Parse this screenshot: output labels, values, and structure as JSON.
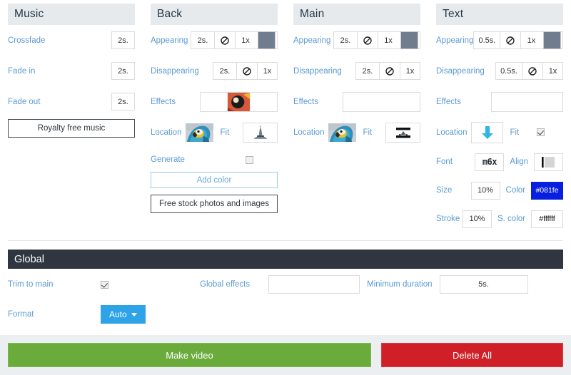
{
  "panels": [
    {
      "title": "Music",
      "rows": [
        {
          "label": "Crossfade",
          "value": "2s."
        },
        {
          "label": "Fade in",
          "value": "2s."
        },
        {
          "label": "Fade out",
          "value": "2s."
        }
      ],
      "button": "Royalty free music"
    },
    {
      "title": "Back",
      "appearing": {
        "label": "Appearing",
        "duration": "2s.",
        "speed": "1x",
        "icon": "no-entry-icon",
        "color": "#707d8f"
      },
      "disappearing": {
        "label": "Disappearing",
        "duration": "2s.",
        "speed": "1x",
        "icon": "no-entry-icon"
      },
      "effects": {
        "label": "Effects",
        "thumb": "effect-thumbnail"
      },
      "location": {
        "label": "Location",
        "thumb": "parrot-thumbnail"
      },
      "fit": {
        "label": "Fit",
        "icon": "tower-fit-icon"
      },
      "generate": {
        "label": "Generate",
        "checked": false
      },
      "add_color": "Add color",
      "free_stock": "Free stock photos and images"
    },
    {
      "title": "Main",
      "appearing": {
        "label": "Appearing",
        "duration": "2s.",
        "speed": "1x",
        "icon": "no-entry-icon",
        "color": "#707d8f"
      },
      "disappearing": {
        "label": "Disappearing",
        "duration": "2s.",
        "speed": "1x",
        "icon": "no-entry-icon"
      },
      "effects": {
        "label": "Effects",
        "value": ""
      },
      "location": {
        "label": "Location",
        "thumb": "parrot-thumbnail"
      },
      "fit": {
        "label": "Fit",
        "icon": "crop-bars-fit-icon"
      }
    },
    {
      "title": "Text",
      "appearing": {
        "label": "Appearing",
        "duration": "0.5s.",
        "speed": "1x",
        "icon": "no-entry-icon",
        "color": "#707d8f"
      },
      "disappearing": {
        "label": "Disappearing",
        "duration": "0.5s.",
        "speed": "1x",
        "icon": "no-entry-icon"
      },
      "effects": {
        "label": "Effects",
        "value": ""
      },
      "location": {
        "label": "Location",
        "icon": "down-arrow-icon"
      },
      "fit": {
        "label": "Fit",
        "checked": true
      },
      "font": {
        "label": "Font",
        "sample": "m6x"
      },
      "align": {
        "label": "Align",
        "icon": "align-left-icon"
      },
      "size": {
        "label": "Size",
        "value": "10%"
      },
      "color": {
        "label": "Color",
        "value": "#081fe",
        "hex": "#081fe0"
      },
      "stroke": {
        "label": "Stroke",
        "value": "10%"
      },
      "s_color": {
        "label": "S. color",
        "value": "#ffffff"
      }
    }
  ],
  "global": {
    "title": "Global",
    "trim_to_main": {
      "label": "Trim to main",
      "checked": true
    },
    "global_effects": {
      "label": "Global effects",
      "value": ""
    },
    "minimum_duration": {
      "label": "Minimum duration",
      "value": "5s."
    },
    "format": {
      "label": "Format",
      "button": "Auto"
    }
  },
  "footer": {
    "make_video": "Make video",
    "delete_all": "Delete All"
  }
}
